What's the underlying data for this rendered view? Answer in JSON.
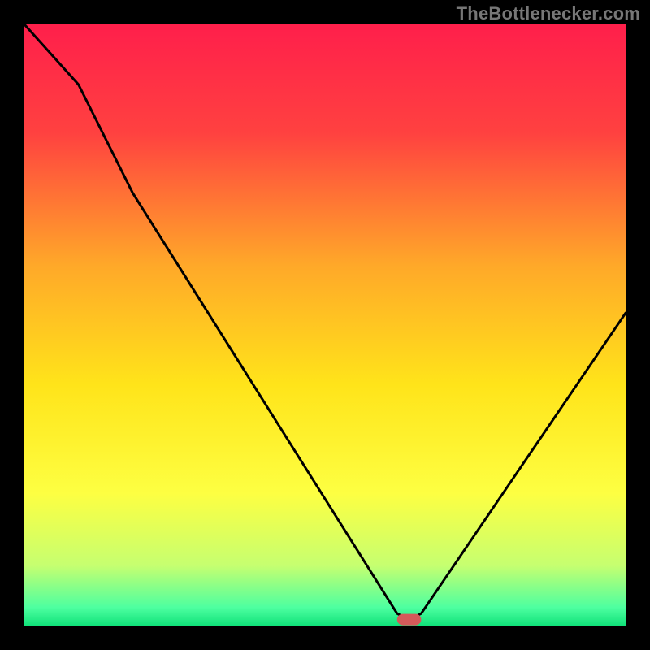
{
  "attribution": "TheBottlenecker.com",
  "chart_data": {
    "type": "line",
    "title": "",
    "xlabel": "",
    "ylabel": "",
    "xlim": [
      0,
      100
    ],
    "ylim": [
      0,
      100
    ],
    "grid": false,
    "background_gradient_stops": [
      {
        "offset": 0,
        "color": "#ff1f4b"
      },
      {
        "offset": 18,
        "color": "#ff4140"
      },
      {
        "offset": 40,
        "color": "#ffa829"
      },
      {
        "offset": 60,
        "color": "#ffe41a"
      },
      {
        "offset": 78,
        "color": "#fdff42"
      },
      {
        "offset": 90,
        "color": "#c6ff70"
      },
      {
        "offset": 97,
        "color": "#4dffa0"
      },
      {
        "offset": 100,
        "color": "#11e27a"
      }
    ],
    "series": [
      {
        "name": "bottleneck-curve",
        "x": [
          0,
          9,
          18,
          62,
          64,
          66,
          100
        ],
        "y": [
          100,
          90,
          72,
          2,
          1,
          2,
          52
        ]
      }
    ],
    "marker": {
      "name": "optimal-point",
      "x_range": [
        62,
        66
      ],
      "y": 1,
      "color": "#d45a5a"
    }
  }
}
